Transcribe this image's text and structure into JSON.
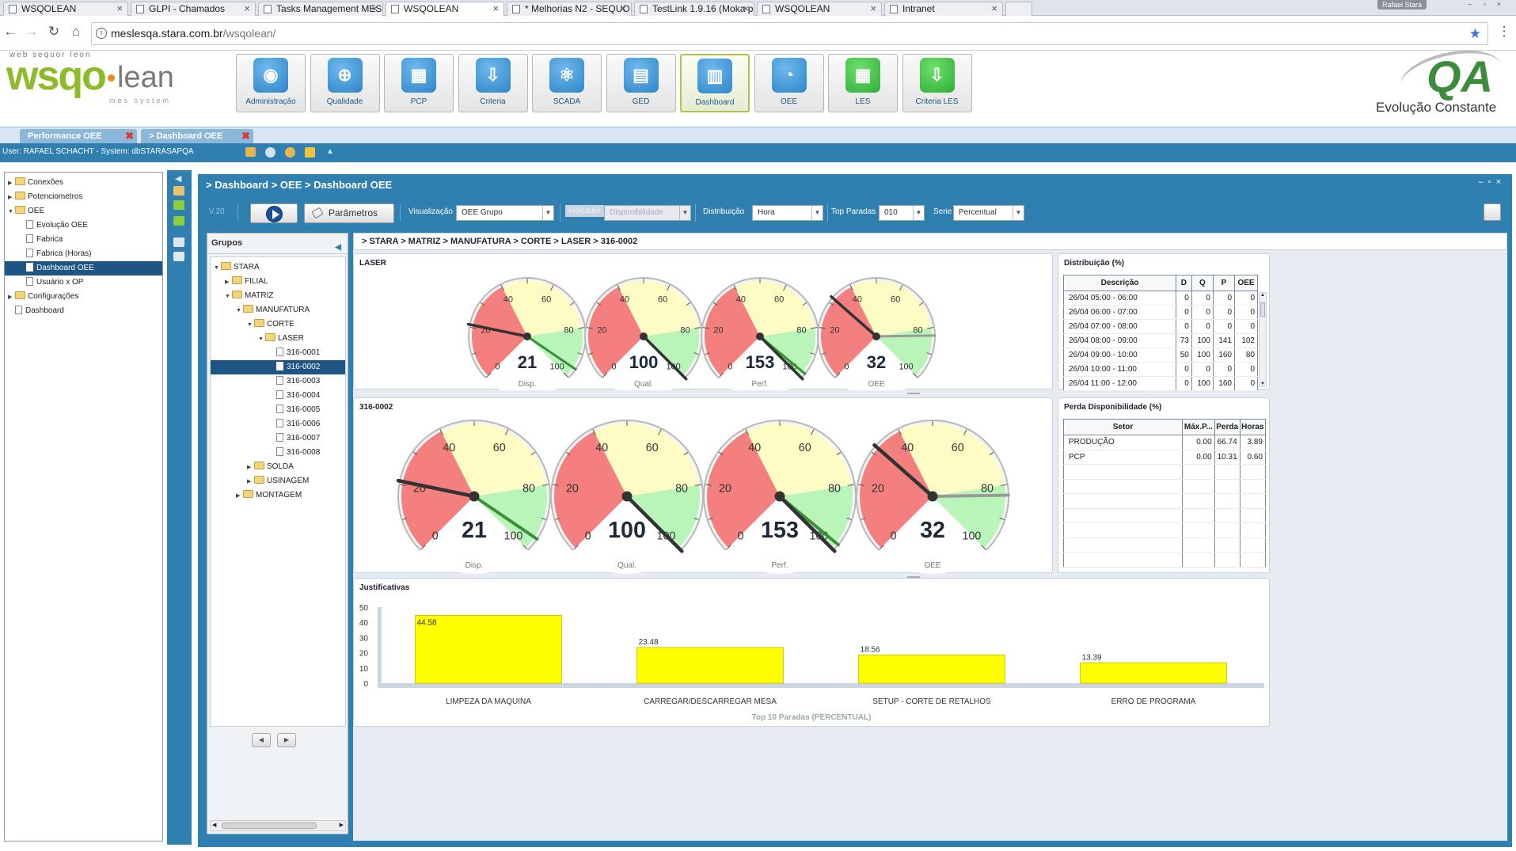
{
  "browser": {
    "tabs": [
      "WSQOLEAN",
      "GLPI - Chamados",
      "Tasks Management MES",
      "WSQOLEAN",
      "* Melhorias N2 - SEQUO",
      "TestLink 1.9.16 (Moka po",
      "WSQOLEAN",
      "Intranet"
    ],
    "user": "Rafael Stara",
    "url_host": "meslesqa.stara.com.br",
    "url_path": "/wsqolean/"
  },
  "header": {
    "logo_top": "web sequor leon",
    "logo_main": "wsqo",
    "logo_lean": "lean",
    "logo_sub": "mes system",
    "brand": "QA",
    "slogan": "Evolução Constante",
    "modules": [
      {
        "label": "Administração",
        "icon": "person-icon"
      },
      {
        "label": "Qualidade",
        "icon": "quality-icon"
      },
      {
        "label": "PCP",
        "icon": "calendar-icon"
      },
      {
        "label": "Criteria",
        "icon": "criteria-icon"
      },
      {
        "label": "SCADA",
        "icon": "atom-icon"
      },
      {
        "label": "GED",
        "icon": "document-icon"
      },
      {
        "label": "Dashboard",
        "icon": "chart-icon"
      },
      {
        "label": "OEE",
        "icon": "gauge-icon"
      },
      {
        "label": "LES",
        "icon": "grid-icon"
      },
      {
        "label": "Criteria LES",
        "icon": "criteria-les-icon"
      }
    ]
  },
  "app_tabs": [
    "Performance OEE",
    "> Dashboard OEE"
  ],
  "userbar": {
    "text": "User: RAFAEL SCHACHT - System: dbSTARASAPQA"
  },
  "left_tree": [
    {
      "label": "Conexões",
      "level": 0,
      "type": "folder",
      "exp": "▶"
    },
    {
      "label": "Potenciometros",
      "level": 0,
      "type": "folder",
      "exp": "▶"
    },
    {
      "label": "OEE",
      "level": 0,
      "type": "folder",
      "exp": "▼"
    },
    {
      "label": "Evolução OEE",
      "level": 1,
      "type": "doc"
    },
    {
      "label": "Fabrica",
      "level": 1,
      "type": "doc"
    },
    {
      "label": "Fabrica (Horas)",
      "level": 1,
      "type": "doc"
    },
    {
      "label": "Dashboard OEE",
      "level": 1,
      "type": "doc",
      "selected": true
    },
    {
      "label": "Usuário x OP",
      "level": 1,
      "type": "doc"
    },
    {
      "label": "Configurações",
      "level": 0,
      "type": "folder",
      "exp": "▶"
    },
    {
      "label": "Dashboard",
      "level": 0,
      "type": "doc"
    }
  ],
  "main": {
    "title": "> Dashboard > OEE > Dashboard OEE",
    "toolbar": {
      "version": "V.20",
      "params_label": "Parâmetros",
      "visualizacao_label": "Visualização",
      "visualizacao_value": "OEE Grupo",
      "indicador_label": "Indicador",
      "indicador_value": "Disponibilidade",
      "distribuicao_label": "Distribuição",
      "distribuicao_value": "Hora",
      "top_paradas_label": "Top Paradas",
      "top_paradas_value": "010",
      "serie_label": "Serie",
      "serie_value": "Percentual"
    },
    "groups": {
      "title": "Grupos",
      "tree": [
        {
          "label": "STARA",
          "level": 0,
          "type": "folder",
          "exp": "▼"
        },
        {
          "label": "FILIAL",
          "level": 1,
          "type": "folder",
          "exp": "▶"
        },
        {
          "label": "MATRIZ",
          "level": 1,
          "type": "folder",
          "exp": "▼"
        },
        {
          "label": "MANUFATURA",
          "level": 2,
          "type": "folder",
          "exp": "▼"
        },
        {
          "label": "CORTE",
          "level": 3,
          "type": "folder",
          "exp": "▼"
        },
        {
          "label": "LASER",
          "level": 4,
          "type": "folder",
          "exp": "▼"
        },
        {
          "label": "316-0001",
          "level": 5,
          "type": "doc"
        },
        {
          "label": "316-0002",
          "level": 5,
          "type": "doc",
          "selected": true
        },
        {
          "label": "316-0003",
          "level": 5,
          "type": "doc"
        },
        {
          "label": "316-0004",
          "level": 5,
          "type": "doc"
        },
        {
          "label": "316-0005",
          "level": 5,
          "type": "doc"
        },
        {
          "label": "316-0006",
          "level": 5,
          "type": "doc"
        },
        {
          "label": "316-0007",
          "level": 5,
          "type": "doc"
        },
        {
          "label": "316-0008",
          "level": 5,
          "type": "doc"
        },
        {
          "label": "SOLDA",
          "level": 3,
          "type": "folder",
          "exp": "▶"
        },
        {
          "label": "USINAGEM",
          "level": 3,
          "type": "folder",
          "exp": "▶"
        },
        {
          "label": "MONTAGEM",
          "level": 2,
          "type": "folder",
          "exp": "▶"
        }
      ]
    },
    "breadcrumb": "> STARA > MATRIZ > MANUFATURA > CORTE > LASER > 316-0002",
    "gauge_ticks": [
      "0",
      "20",
      "40",
      "60",
      "80",
      "100"
    ],
    "colors": {
      "red": "#f47f7f",
      "yellow": "#fcfcc4",
      "green": "#b9f5b8",
      "bar": "#ffff00"
    },
    "laser_panel": {
      "title": "LASER",
      "gauges": [
        {
          "label": "Disp.",
          "value": "21",
          "num": 21,
          "target": 96
        },
        {
          "label": "Qual.",
          "value": "100",
          "num": 100,
          "target": 100
        },
        {
          "label": "Perf.",
          "value": "153",
          "num": 153,
          "target": 98
        },
        {
          "label": "OEE",
          "value": "32",
          "num": 32,
          "target": 83
        }
      ]
    },
    "machine_panel": {
      "title": "316-0002",
      "gauges": [
        {
          "label": "Disp.",
          "value": "21",
          "num": 21,
          "target": 96
        },
        {
          "label": "Qual.",
          "value": "100",
          "num": 100,
          "target": 100
        },
        {
          "label": "Perf.",
          "value": "153",
          "num": 153,
          "target": 98
        },
        {
          "label": "OEE",
          "value": "32",
          "num": 32,
          "target": 83
        }
      ]
    },
    "distribuicao": {
      "title": "Distribuição (%)",
      "headers": [
        "Descrição",
        "D",
        "Q",
        "P",
        "OEE"
      ],
      "rows": [
        [
          "26/04 05:00 - 06:00",
          "0",
          "0",
          "0",
          "0"
        ],
        [
          "26/04 06:00 - 07:00",
          "0",
          "0",
          "0",
          "0"
        ],
        [
          "26/04 07:00 - 08:00",
          "0",
          "0",
          "0",
          "0"
        ],
        [
          "26/04 08:00 - 09:00",
          "73",
          "100",
          "141",
          "102"
        ],
        [
          "26/04 09:00 - 10:00",
          "50",
          "100",
          "160",
          "80"
        ],
        [
          "26/04 10:00 - 11:00",
          "0",
          "0",
          "0",
          "0"
        ],
        [
          "26/04 11:00 - 12:00",
          "0",
          "100",
          "160",
          "0"
        ]
      ]
    },
    "perda": {
      "title": "Perda Disponibilidade (%)",
      "headers": [
        "Setor",
        "Máx.P...",
        "Perda",
        "Horas"
      ],
      "rows": [
        [
          "PRODUÇÃO",
          "0.00",
          "66.74",
          "3.89"
        ],
        [
          "PCP",
          "0.00",
          "10.31",
          "0.60"
        ]
      ]
    },
    "justificativas": {
      "title": "Justificativas",
      "chart_caption": "Top 10 Paradas (PERCENTUAL)"
    }
  },
  "chart_data": {
    "type": "bar",
    "title": "Top 10 Paradas (PERCENTUAL)",
    "categories": [
      "LIMPEZA DA MAQUINA",
      "CARREGAR/DESCARREGAR MESA",
      "SETUP - CORTE DE RETALHOS",
      "ERRO DE PROGRAMA"
    ],
    "values": [
      44.58,
      23.48,
      18.56,
      13.39
    ],
    "labels": [
      "44.58",
      "23.48",
      "18.56",
      "13.39"
    ],
    "ylim": [
      0,
      50
    ],
    "yticks": [
      "0",
      "10",
      "20",
      "30",
      "40",
      "50"
    ],
    "xlabel": "",
    "ylabel": "",
    "grid": false,
    "color": "#ffff00"
  }
}
